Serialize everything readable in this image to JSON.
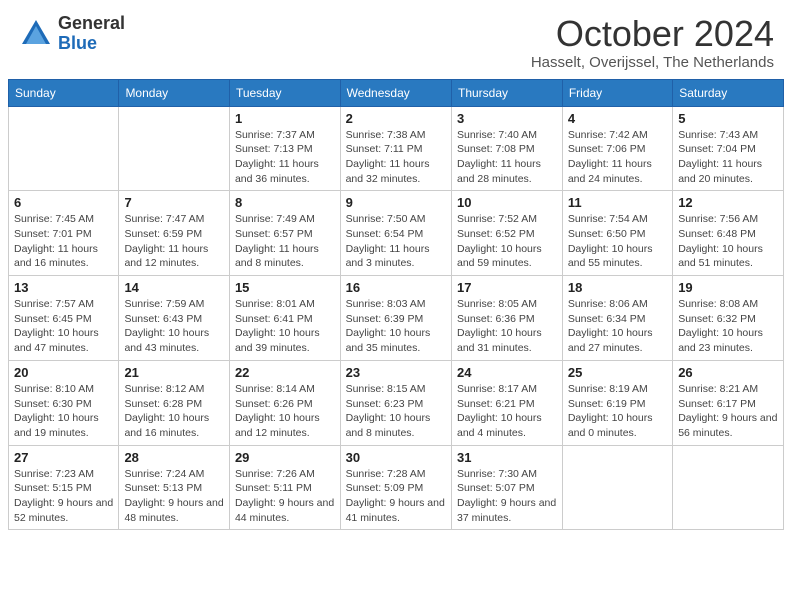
{
  "header": {
    "logo_general": "General",
    "logo_blue": "Blue",
    "month_title": "October 2024",
    "subtitle": "Hasselt, Overijssel, The Netherlands"
  },
  "days_of_week": [
    "Sunday",
    "Monday",
    "Tuesday",
    "Wednesday",
    "Thursday",
    "Friday",
    "Saturday"
  ],
  "weeks": [
    [
      {
        "day": "",
        "info": ""
      },
      {
        "day": "",
        "info": ""
      },
      {
        "day": "1",
        "info": "Sunrise: 7:37 AM\nSunset: 7:13 PM\nDaylight: 11 hours and 36 minutes."
      },
      {
        "day": "2",
        "info": "Sunrise: 7:38 AM\nSunset: 7:11 PM\nDaylight: 11 hours and 32 minutes."
      },
      {
        "day": "3",
        "info": "Sunrise: 7:40 AM\nSunset: 7:08 PM\nDaylight: 11 hours and 28 minutes."
      },
      {
        "day": "4",
        "info": "Sunrise: 7:42 AM\nSunset: 7:06 PM\nDaylight: 11 hours and 24 minutes."
      },
      {
        "day": "5",
        "info": "Sunrise: 7:43 AM\nSunset: 7:04 PM\nDaylight: 11 hours and 20 minutes."
      }
    ],
    [
      {
        "day": "6",
        "info": "Sunrise: 7:45 AM\nSunset: 7:01 PM\nDaylight: 11 hours and 16 minutes."
      },
      {
        "day": "7",
        "info": "Sunrise: 7:47 AM\nSunset: 6:59 PM\nDaylight: 11 hours and 12 minutes."
      },
      {
        "day": "8",
        "info": "Sunrise: 7:49 AM\nSunset: 6:57 PM\nDaylight: 11 hours and 8 minutes."
      },
      {
        "day": "9",
        "info": "Sunrise: 7:50 AM\nSunset: 6:54 PM\nDaylight: 11 hours and 3 minutes."
      },
      {
        "day": "10",
        "info": "Sunrise: 7:52 AM\nSunset: 6:52 PM\nDaylight: 10 hours and 59 minutes."
      },
      {
        "day": "11",
        "info": "Sunrise: 7:54 AM\nSunset: 6:50 PM\nDaylight: 10 hours and 55 minutes."
      },
      {
        "day": "12",
        "info": "Sunrise: 7:56 AM\nSunset: 6:48 PM\nDaylight: 10 hours and 51 minutes."
      }
    ],
    [
      {
        "day": "13",
        "info": "Sunrise: 7:57 AM\nSunset: 6:45 PM\nDaylight: 10 hours and 47 minutes."
      },
      {
        "day": "14",
        "info": "Sunrise: 7:59 AM\nSunset: 6:43 PM\nDaylight: 10 hours and 43 minutes."
      },
      {
        "day": "15",
        "info": "Sunrise: 8:01 AM\nSunset: 6:41 PM\nDaylight: 10 hours and 39 minutes."
      },
      {
        "day": "16",
        "info": "Sunrise: 8:03 AM\nSunset: 6:39 PM\nDaylight: 10 hours and 35 minutes."
      },
      {
        "day": "17",
        "info": "Sunrise: 8:05 AM\nSunset: 6:36 PM\nDaylight: 10 hours and 31 minutes."
      },
      {
        "day": "18",
        "info": "Sunrise: 8:06 AM\nSunset: 6:34 PM\nDaylight: 10 hours and 27 minutes."
      },
      {
        "day": "19",
        "info": "Sunrise: 8:08 AM\nSunset: 6:32 PM\nDaylight: 10 hours and 23 minutes."
      }
    ],
    [
      {
        "day": "20",
        "info": "Sunrise: 8:10 AM\nSunset: 6:30 PM\nDaylight: 10 hours and 19 minutes."
      },
      {
        "day": "21",
        "info": "Sunrise: 8:12 AM\nSunset: 6:28 PM\nDaylight: 10 hours and 16 minutes."
      },
      {
        "day": "22",
        "info": "Sunrise: 8:14 AM\nSunset: 6:26 PM\nDaylight: 10 hours and 12 minutes."
      },
      {
        "day": "23",
        "info": "Sunrise: 8:15 AM\nSunset: 6:23 PM\nDaylight: 10 hours and 8 minutes."
      },
      {
        "day": "24",
        "info": "Sunrise: 8:17 AM\nSunset: 6:21 PM\nDaylight: 10 hours and 4 minutes."
      },
      {
        "day": "25",
        "info": "Sunrise: 8:19 AM\nSunset: 6:19 PM\nDaylight: 10 hours and 0 minutes."
      },
      {
        "day": "26",
        "info": "Sunrise: 8:21 AM\nSunset: 6:17 PM\nDaylight: 9 hours and 56 minutes."
      }
    ],
    [
      {
        "day": "27",
        "info": "Sunrise: 7:23 AM\nSunset: 5:15 PM\nDaylight: 9 hours and 52 minutes."
      },
      {
        "day": "28",
        "info": "Sunrise: 7:24 AM\nSunset: 5:13 PM\nDaylight: 9 hours and 48 minutes."
      },
      {
        "day": "29",
        "info": "Sunrise: 7:26 AM\nSunset: 5:11 PM\nDaylight: 9 hours and 44 minutes."
      },
      {
        "day": "30",
        "info": "Sunrise: 7:28 AM\nSunset: 5:09 PM\nDaylight: 9 hours and 41 minutes."
      },
      {
        "day": "31",
        "info": "Sunrise: 7:30 AM\nSunset: 5:07 PM\nDaylight: 9 hours and 37 minutes."
      },
      {
        "day": "",
        "info": ""
      },
      {
        "day": "",
        "info": ""
      }
    ]
  ]
}
